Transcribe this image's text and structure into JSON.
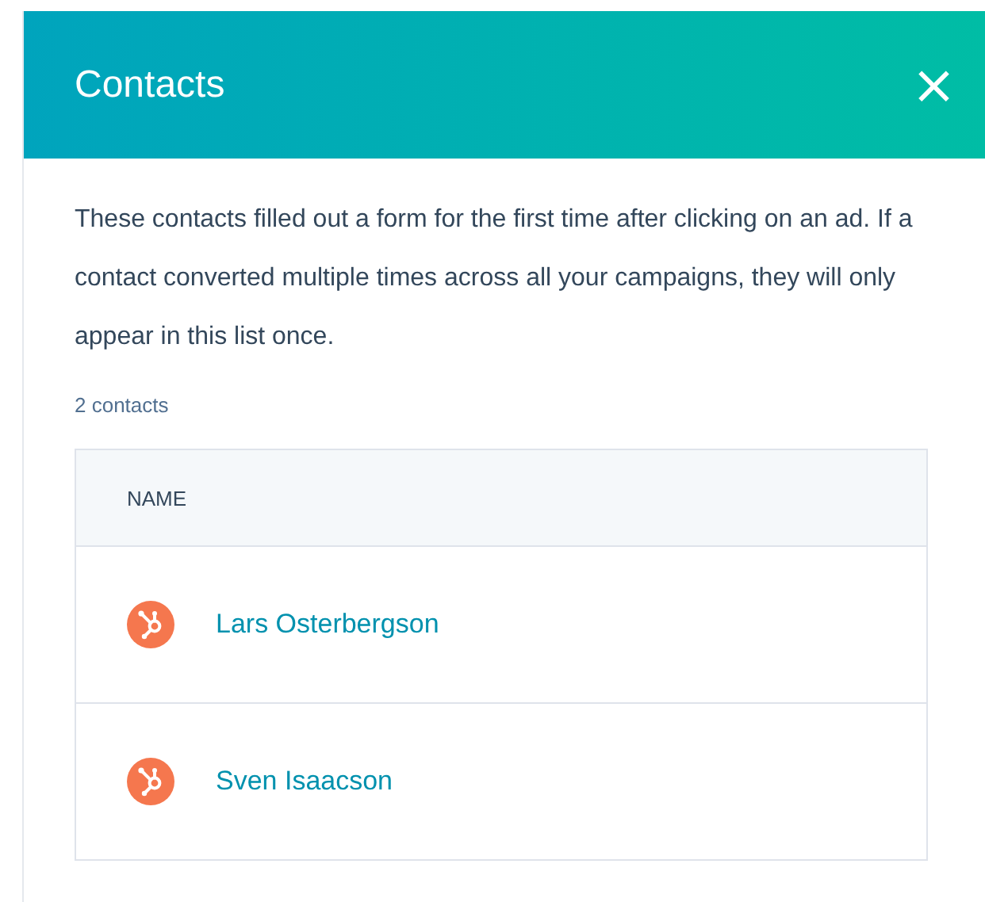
{
  "panel": {
    "title": "Contacts",
    "close": "×"
  },
  "description": "These contacts filled out a form for the first time after clicking on an ad. If a contact converted multiple times across all your campaigns, they will only appear in this list once.",
  "count": "2 contacts",
  "table": {
    "columns": [
      "NAME"
    ],
    "rows": [
      {
        "name": "Lars Osterbergson"
      },
      {
        "name": "Sven Isaacson"
      }
    ]
  }
}
